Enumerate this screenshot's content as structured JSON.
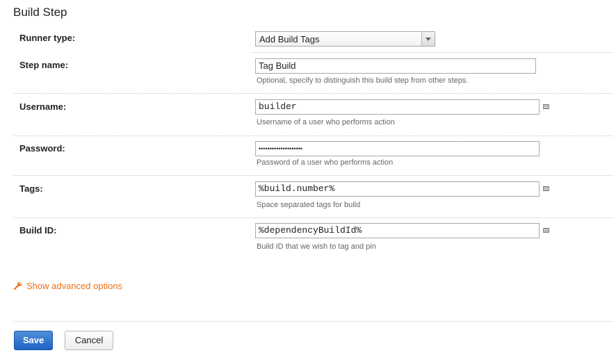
{
  "page": {
    "title": "Build Step"
  },
  "fields": {
    "runner_type": {
      "label": "Runner type:",
      "value": "Add Build Tags"
    },
    "step_name": {
      "label": "Step name:",
      "value": "Tag Build",
      "hint": "Optional, specify to distinguish this build step from other steps."
    },
    "username": {
      "label": "Username:",
      "value": "builder",
      "hint": "Username of a user who performs action"
    },
    "password": {
      "label": "Password:",
      "value": "••••••••••••••••••••",
      "hint": "Password of a user who performs action"
    },
    "tags": {
      "label": "Tags:",
      "value": "%build.number%",
      "hint": "Space separated tags for build"
    },
    "build_id": {
      "label": "Build ID:",
      "value": "%dependencyBuildId%",
      "hint": "Build ID that we wish to tag and pin"
    }
  },
  "advanced": {
    "label": "Show advanced options",
    "icon": "wrench-icon"
  },
  "actions": {
    "save": "Save",
    "cancel": "Cancel"
  },
  "colors": {
    "link": "#e8711b",
    "primary_button": "#2a6fcf"
  }
}
